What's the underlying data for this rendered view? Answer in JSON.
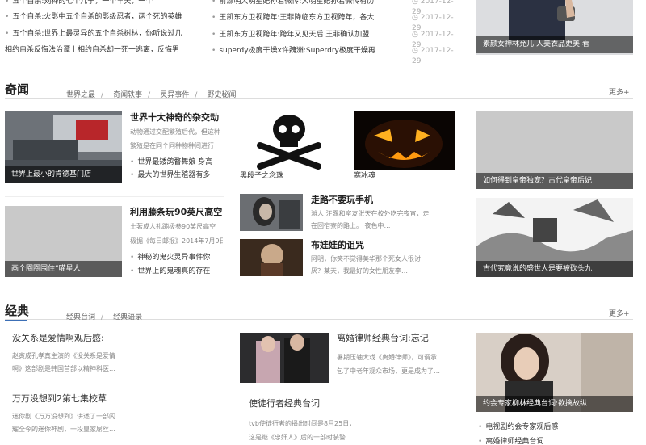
{
  "top_lists": {
    "left": [
      "五个自杀:刘禅的七个儿子，一个早夭，一个",
      "五个自杀:火影中五个自杀的影级忍者，两个死的英雄",
      "五个自杀:世界上最灵异的五个自杀树林，你听说过几",
      "相约自杀反悔法治谭丨相约自杀却一死一逃离，反悔男"
    ],
    "middle": [
      {
        "title": "俞灏明大明星妃孙若微传:大明星妃孙若微传有历",
        "date": "2017-12-29"
      },
      {
        "title": "王凯东方卫视跨年:王菲降临东方卫视跨年，各大",
        "date": "2017-12-29"
      },
      {
        "title": "王凯东方卫视跨年:跨年又见天后 王菲确认加盟",
        "date": "2017-12-29"
      },
      {
        "title": "superdy极度干燥x许魏洲:Superdry极度干燥再",
        "date": "2017-12-29"
      }
    ],
    "right_caption": "素颜女神林允儿:人美衣品更美 看"
  },
  "qiwen": {
    "title": "奇闻",
    "tabs": [
      "世界之最",
      "奇闻轶事",
      "灵异事件",
      "野史秘闻"
    ],
    "more": "更多+",
    "feature1": {
      "caption": "世界上最小的肯德基门店",
      "title": "世界十大神奇的杂交动",
      "desc": [
        "动物通过交配繁殖后代，但这种",
        "繁殖是在同个同种物种间进行"
      ],
      "links": [
        "世界最矮鸽瞀舞娘 身高",
        "最大的世界生殖器有多"
      ]
    },
    "feature2": {
      "caption": "画个圈圈围住“喵星人",
      "title": "利用藤条玩90英尺高空",
      "desc": [
        "土著成人礼蹦极参90英尺高空",
        "极据《每日邮报》2014年7月9日"
      ],
      "links": [
        "神秘的鬼火灵异事件你",
        "世界上的鬼魂真的存在"
      ]
    },
    "thumb1_label": "黑段子之念珠",
    "thumb2_label": "寒冰魂",
    "story1": {
      "title": "走路不要玩手机",
      "desc": [
        "滩人 汪露和室友张天在校外吃完夜宵，走",
        "在回宿寮的路上。 夜色中…"
      ]
    },
    "story2": {
      "title": "布娃娃的诅咒",
      "desc": [
        "阿明，你笑不觉得美华那个死女人很讨",
        "厌？某天，我最好的女性朋友李…"
      ]
    },
    "right1_caption": "如何得到皇帝独宠？古代皇帝后妃",
    "right2_caption": "古代究竟说的盛世人是要被砍头九"
  },
  "jingdian": {
    "title": "经典",
    "tabs": [
      "经典台词",
      "经典语录"
    ],
    "more": "更多+",
    "item1": {
      "title": "没关系是爱情啊观后感:",
      "desc": [
        "赵寅成孔孝真主演的《没关系是爱情",
        "啊》这部剧是韩国首部以精神科医…"
      ]
    },
    "item2": {
      "title": "万万没想到2第七集校草",
      "desc": [
        "迷你剧《万万没想到》讲述了一部闪",
        "耀全今的迷你神剧，一段皇家屌丝…"
      ]
    },
    "story1": {
      "title": "离婚律师经典台词:忘记",
      "desc": [
        "暑期压轴大戏《离婚律师》，可谓承",
        "包了中老年观众市场，更是成为了…"
      ]
    },
    "story2": {
      "title": "使徒行者经典台词",
      "desc": [
        "tvb使徒行者的播出时间是8月25日，",
        "这是继《忠奸人》后的一部时装警…"
      ]
    },
    "right_caption": "约会专家柳林经典台词:欲擒故纵",
    "right_links": [
      "电视剧约会专家观后感",
      "离婚律师经典台词"
    ]
  }
}
